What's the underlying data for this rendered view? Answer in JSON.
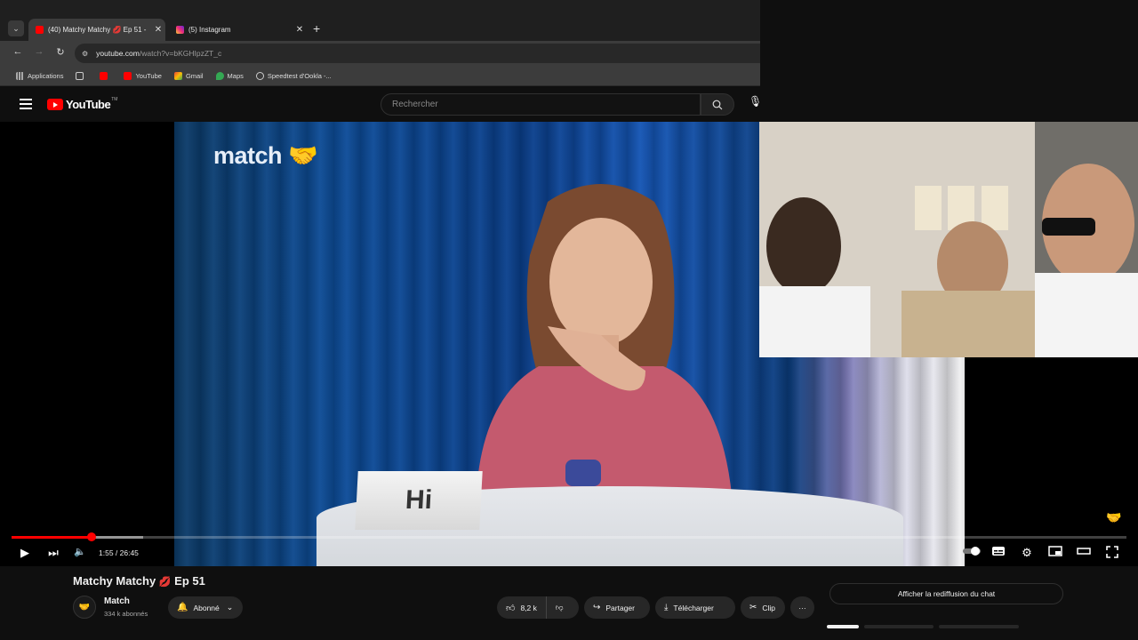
{
  "browser": {
    "tabs": [
      {
        "title": "(40) Matchy Matchy 💋 Ep 51 -",
        "favicon": "youtube-icon",
        "active": true
      },
      {
        "title": "(5) Instagram",
        "favicon": "instagram-icon",
        "active": false
      }
    ],
    "url": {
      "host": "youtube.com",
      "path": "/watch?v=bKGHIpzZT_c"
    },
    "bookmarks": [
      {
        "label": "Applications",
        "icon": "apps-grid-icon"
      },
      {
        "label": "",
        "icon": "grid-icon"
      },
      {
        "label": "",
        "icon": "youtube-icon"
      },
      {
        "label": "YouTube",
        "icon": "youtube-icon"
      },
      {
        "label": "Gmail",
        "icon": "gmail-icon"
      },
      {
        "label": "Maps",
        "icon": "maps-pin-icon"
      },
      {
        "label": "Speedtest d'Ookla -...",
        "icon": "speedtest-icon"
      }
    ]
  },
  "youtube": {
    "logo_text": "YouTube",
    "logo_tm": "TM",
    "search_placeholder": "Rechercher"
  },
  "player": {
    "overlay_logo": "match",
    "name_card": "Hi",
    "time_current": "1:55",
    "time_total": "26:45",
    "time_display": "1:55 / 26:45",
    "progress_fraction": 0.072,
    "buffer_fraction": 0.118
  },
  "video": {
    "title": "Matchy Matchy",
    "title_emoji": "💋",
    "episode": "Ep 51",
    "channel_name": "Match",
    "subscribers": "334 k abonnés",
    "subscribe_label": "Abonné",
    "likes": "8,2 k",
    "share_label": "Partager",
    "download_label": "Télécharger",
    "clip_label": "Clip",
    "more_label": "···",
    "chat_replay_label": "Afficher la rediffusion du chat"
  },
  "colors": {
    "accent": "#ff0000",
    "background": "#0f0f0f",
    "pill": "#272727"
  }
}
